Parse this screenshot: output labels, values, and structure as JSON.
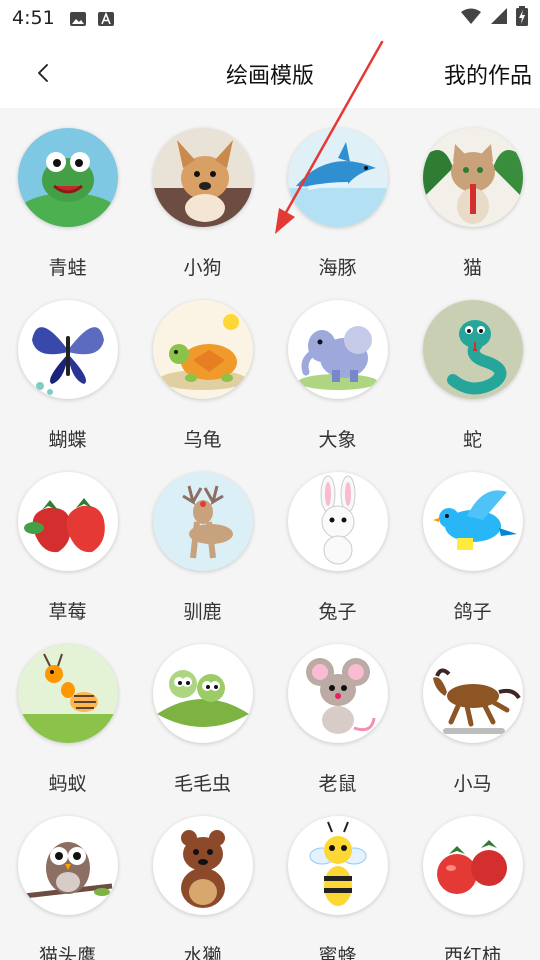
{
  "status_bar": {
    "time": "4:51",
    "icons": [
      "image-icon",
      "font-a-icon",
      "wifi-icon",
      "signal-icon",
      "battery-charging-icon"
    ]
  },
  "header": {
    "back_icon": "chevron-left-icon",
    "title": "绘画模版",
    "my_works": "我的作品"
  },
  "templates": [
    {
      "label": "青蛙",
      "icon": "frog-icon",
      "bg": "#7ec8e3"
    },
    {
      "label": "小狗",
      "icon": "dog-icon",
      "bg": "#e9e2d6"
    },
    {
      "label": "海豚",
      "icon": "dolphin-icon",
      "bg": "#dff0f7"
    },
    {
      "label": "猫",
      "icon": "cat-icon",
      "bg": "#f3f0ea"
    },
    {
      "label": "蝴蝶",
      "icon": "butterfly-icon",
      "bg": "#ffffff"
    },
    {
      "label": "乌龟",
      "icon": "turtle-icon",
      "bg": "#fbf4e4"
    },
    {
      "label": "大象",
      "icon": "elephant-icon",
      "bg": "#ffffff"
    },
    {
      "label": "蛇",
      "icon": "snake-icon",
      "bg": "#c9cfb2"
    },
    {
      "label": "草莓",
      "icon": "strawberry-icon",
      "bg": "#ffffff"
    },
    {
      "label": "驯鹿",
      "icon": "reindeer-icon",
      "bg": "#dbeff6"
    },
    {
      "label": "兔子",
      "icon": "rabbit-icon",
      "bg": "#ffffff"
    },
    {
      "label": "鸽子",
      "icon": "pigeon-icon",
      "bg": "#ffffff"
    },
    {
      "label": "蚂蚁",
      "icon": "ant-icon",
      "bg": "#e4f2d6"
    },
    {
      "label": "毛毛虫",
      "icon": "caterpillar-icon",
      "bg": "#ffffff"
    },
    {
      "label": "老鼠",
      "icon": "mouse-icon",
      "bg": "#ffffff"
    },
    {
      "label": "小马",
      "icon": "horse-icon",
      "bg": "#ffffff"
    },
    {
      "label": "猫头鹰",
      "icon": "owl-icon",
      "bg": "#ffffff"
    },
    {
      "label": "水獭",
      "icon": "otter-icon",
      "bg": "#ffffff"
    },
    {
      "label": "蜜蜂",
      "icon": "bee-icon",
      "bg": "#ffffff"
    },
    {
      "label": "西红柿",
      "icon": "tomato-icon",
      "bg": "#ffffff"
    }
  ],
  "annotation": {
    "icon": "pointer-arrow-icon",
    "color": "#e53935"
  }
}
